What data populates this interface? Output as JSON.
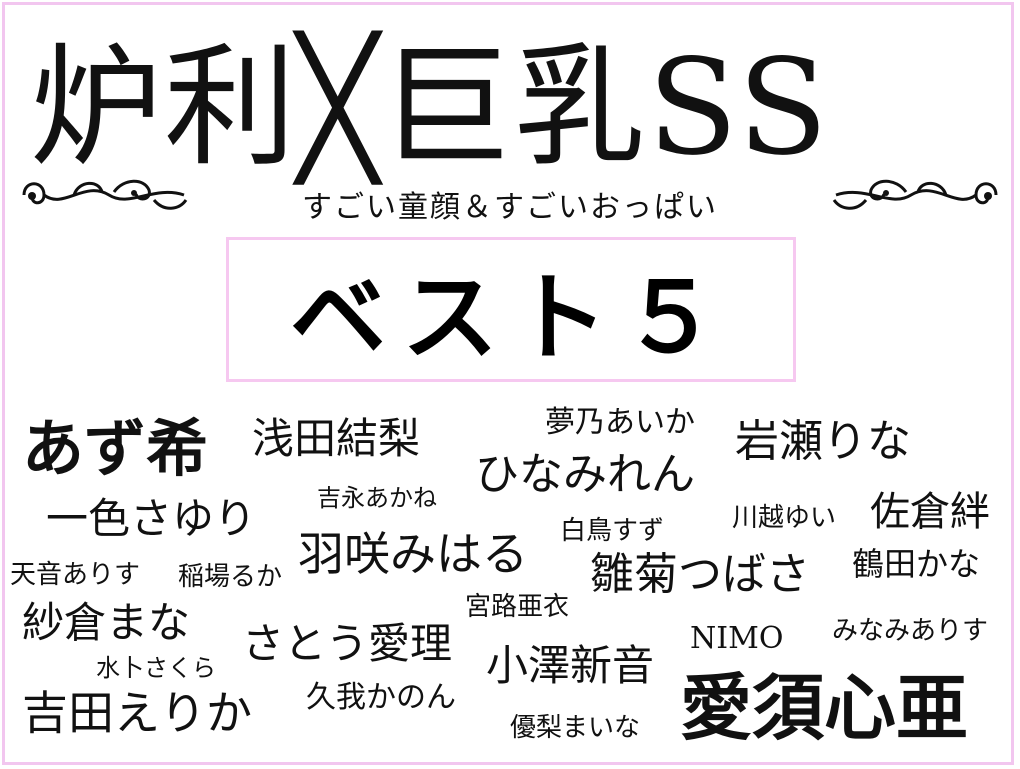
{
  "title": "炉利╳巨乳SS",
  "subtitle": "すごい童顔＆すごいおっぱい",
  "banner": "ベスト５",
  "names": {
    "n01": "あず希",
    "n02": "浅田結梨",
    "n03": "夢乃あいか",
    "n04": "岩瀬りな",
    "n05": "ひなみれん",
    "n06": "一色さゆり",
    "n07": "吉永あかね",
    "n08": "白鳥すず",
    "n09": "川越ゆい",
    "n10": "佐倉絆",
    "n11": "羽咲みはる",
    "n12": "天音ありす",
    "n13": "稲場るか",
    "n14": "雛菊つばさ",
    "n15": "鶴田かな",
    "n16": "宮路亜衣",
    "n17": "紗倉まな",
    "n18": "さとう愛理",
    "n19": "NIMO",
    "n20": "みなみありす",
    "n21": "水卜さくら",
    "n22": "小澤新音",
    "n23": "吉田えりか",
    "n24": "久我かのん",
    "n25": "愛須心亜",
    "n26": "優梨まいな"
  }
}
